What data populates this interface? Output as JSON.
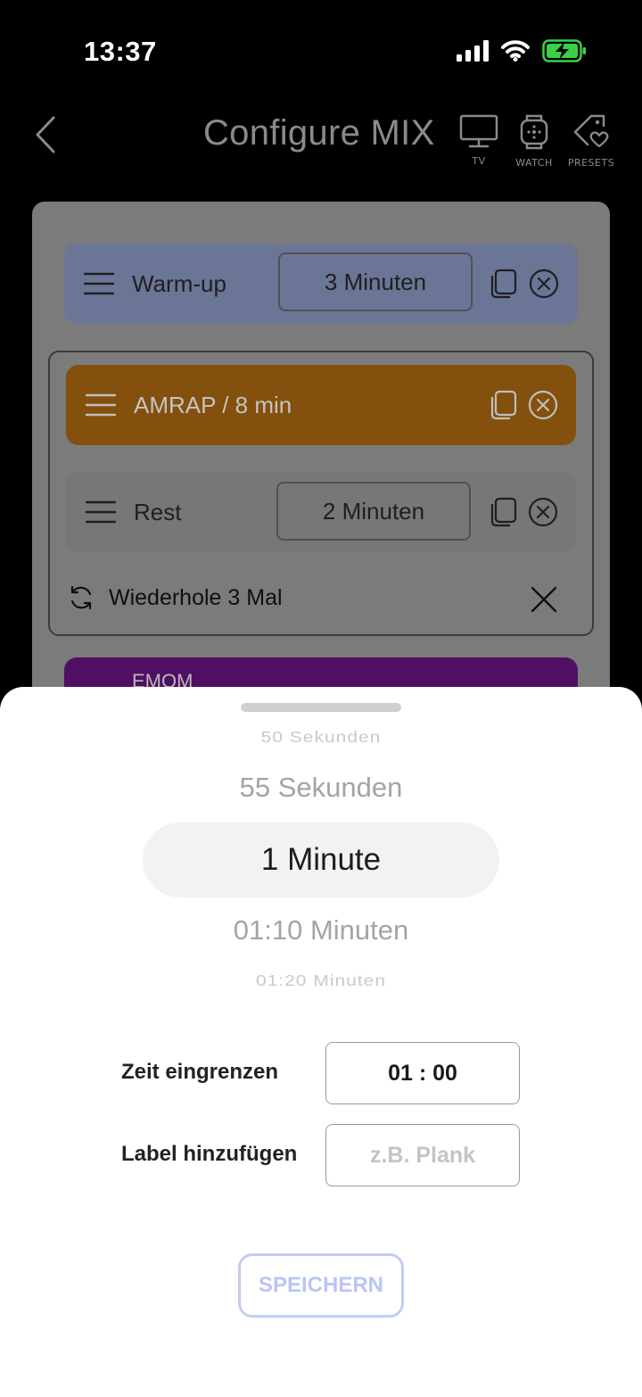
{
  "status_bar": {
    "time": "13:37"
  },
  "header": {
    "title": "Configure MIX",
    "buttons": [
      {
        "label": "TV",
        "icon": "tv-icon"
      },
      {
        "label": "WATCH",
        "icon": "watch-icon"
      },
      {
        "label": "PRESETS",
        "icon": "tag-heart-icon"
      }
    ]
  },
  "blocks": [
    {
      "label": "Warm-up",
      "duration": "3 Minuten",
      "color": "#6b7596"
    },
    {
      "label": "AMRAP / 8 min",
      "color": "#84500d"
    },
    {
      "label": "Rest",
      "duration": "2 Minuten",
      "color": "#777777"
    },
    {
      "label": "EMOM",
      "color": "#4f0f63"
    }
  ],
  "repeat": {
    "text": "Wiederhole 3 Mal"
  },
  "picker": {
    "items": [
      "50 Sekunden",
      "55 Sekunden",
      "1 Minute",
      "01:10 Minuten",
      "01:20 Minuten"
    ],
    "selected": "1 Minute"
  },
  "form": {
    "time_label": "Zeit eingrenzen",
    "time_value": "01 : 00",
    "label_label": "Label hinzufügen",
    "label_placeholder": "z.B. Plank"
  },
  "save_label": "SPEICHERN"
}
